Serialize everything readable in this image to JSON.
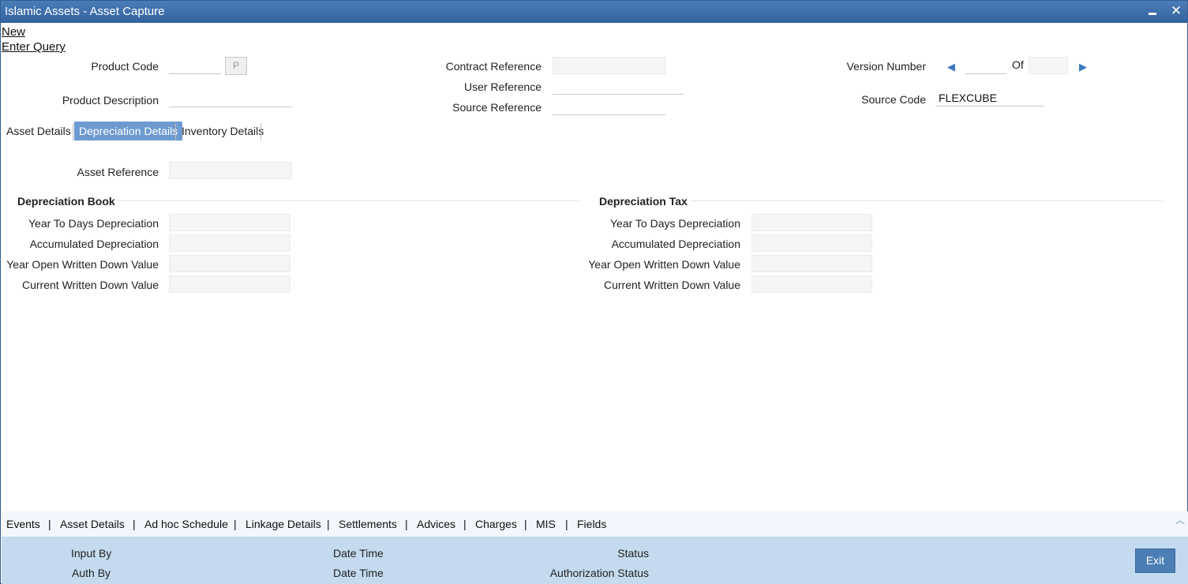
{
  "window": {
    "title": "Islamic Assets - Asset Capture",
    "minimize_label": "",
    "close_label": "✕"
  },
  "menu": {
    "new": "New",
    "enter_query": "Enter Query"
  },
  "header": {
    "product_code_label": "Product Code",
    "product_code_value": "",
    "product_button_label": "P",
    "product_description_label": "Product Description",
    "product_description_value": "",
    "contract_reference_label": "Contract Reference",
    "contract_reference_value": "",
    "user_reference_label": "User Reference",
    "user_reference_value": "",
    "source_reference_label": "Source Reference",
    "source_reference_value": "",
    "version_number_label": "Version Number",
    "version_number_value": "",
    "of_label": "Of",
    "of_value": "",
    "source_code_label": "Source Code",
    "source_code_value": "FLEXCUBE"
  },
  "tabs": [
    {
      "label": "Asset Details",
      "active": false
    },
    {
      "label": "Depreciation Details",
      "active": true
    },
    {
      "label": "Inventory Details",
      "active": false
    }
  ],
  "depreciation": {
    "asset_reference_label": "Asset Reference",
    "asset_reference_value": "",
    "book": {
      "title": "Depreciation Book",
      "rows": [
        {
          "label": "Year To Days Depreciation",
          "value": ""
        },
        {
          "label": "Accumulated Depreciation",
          "value": ""
        },
        {
          "label": "Year Open Written Down Value",
          "value": ""
        },
        {
          "label": "Current Written Down Value",
          "value": ""
        }
      ]
    },
    "tax": {
      "title": "Depreciation Tax",
      "rows": [
        {
          "label": "Year To Days Depreciation",
          "value": ""
        },
        {
          "label": "Accumulated Depreciation",
          "value": ""
        },
        {
          "label": "Year Open Written Down Value",
          "value": ""
        },
        {
          "label": "Current Written Down Value",
          "value": ""
        }
      ]
    }
  },
  "bottom_nav": {
    "items": [
      "Events",
      "Asset Details",
      "Ad hoc Schedule",
      "Linkage Details",
      "Settlements",
      "Advices",
      "Charges",
      "MIS",
      "Fields"
    ],
    "separator": "|"
  },
  "footer": {
    "input_by": "Input By",
    "auth_by": "Auth By",
    "date_time_1": "Date Time",
    "date_time_2": "Date Time",
    "status": "Status",
    "authorization_status": "Authorization Status",
    "exit_label": "Exit"
  },
  "colors": {
    "titlebar": "#33639f",
    "active_tab": "#6d9bd1",
    "footer": "#c4dbef",
    "exit_button": "#4a7eb5"
  }
}
